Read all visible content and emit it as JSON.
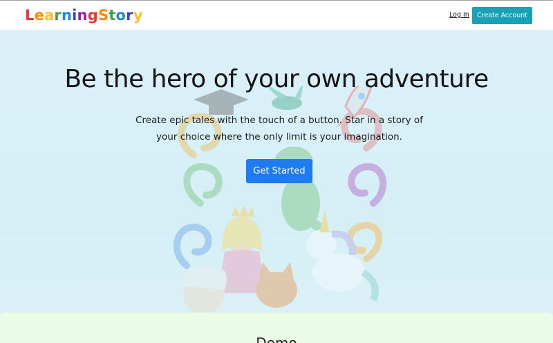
{
  "navbar": {
    "logo_letters": [
      {
        "char": "L",
        "color": "#e53935"
      },
      {
        "char": "e",
        "color": "#fb8c00"
      },
      {
        "char": "a",
        "color": "#fbc02d"
      },
      {
        "char": "r",
        "color": "#43a047"
      },
      {
        "char": "n",
        "color": "#1e88e5"
      },
      {
        "char": "i",
        "color": "#3949ab"
      },
      {
        "char": "n",
        "color": "#8e24aa"
      },
      {
        "char": "g",
        "color": "#e53935"
      },
      {
        "char": "S",
        "color": "#fb8c00"
      },
      {
        "char": "t",
        "color": "#43a047"
      },
      {
        "char": "o",
        "color": "#1e88e5"
      },
      {
        "char": "r",
        "color": "#3949ab"
      },
      {
        "char": "y",
        "color": "#fbc02d"
      }
    ],
    "login_label": "Log In",
    "create_account_label": "Create Account"
  },
  "hero": {
    "title": "Be the hero of your own adventure",
    "subtitle": "Create epic tales with the touch of a button. Star in a story of your choice where the only limit is your imagination.",
    "cta_label": "Get Started"
  },
  "demo": {
    "title": "Demo"
  },
  "colors": {
    "accent_teal": "#17a2b8",
    "primary_blue": "#1f7cf0",
    "hero_bg": "#dbf1f8",
    "demo_bg": "#eafbe6"
  }
}
